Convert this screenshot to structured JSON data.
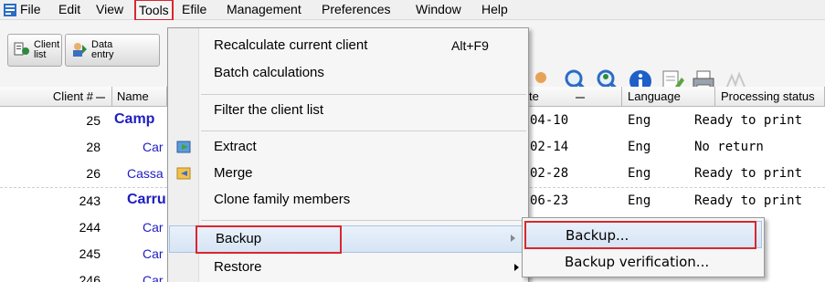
{
  "menubar": {
    "items": [
      "File",
      "Edit",
      "View",
      "Tools",
      "Efile",
      "Management",
      "Preferences",
      "Window",
      "Help"
    ]
  },
  "toolbar": {
    "client_list_line1": "Client",
    "client_list_line2": "list",
    "data_entry_line1": "Data",
    "data_entry_line2": "entry"
  },
  "grid": {
    "headers": {
      "client_no": "Client #",
      "name": "Name",
      "date": "te",
      "language": "Language",
      "processing_status": "Processing status"
    },
    "rows": [
      {
        "num": "25",
        "name": "Camp",
        "date": "04-10",
        "language": "Eng",
        "status": "Ready to print"
      },
      {
        "num": "28",
        "name": "Car",
        "date": "02-14",
        "language": "Eng",
        "status": "No return"
      },
      {
        "num": "26",
        "name": "Cassa",
        "date": "02-28",
        "language": "Eng",
        "status": "Ready to print"
      },
      {
        "num": "243",
        "name": "Carru",
        "date": "06-23",
        "language": "Eng",
        "status": "Ready to print"
      },
      {
        "num": "244",
        "name": "Car",
        "date": "",
        "language": "",
        "status": ""
      },
      {
        "num": "245",
        "name": "Car",
        "date": "",
        "language": "",
        "status": ""
      },
      {
        "num": "246",
        "name": "Car",
        "date": "",
        "language": "",
        "status": ""
      }
    ]
  },
  "tools_menu": {
    "items": [
      {
        "label": "Recalculate current client",
        "shortcut": "Alt+F9"
      },
      {
        "label": "Batch calculations"
      },
      {
        "label": "Filter the client list"
      },
      {
        "label": "Extract"
      },
      {
        "label": "Merge"
      },
      {
        "label": "Clone family members"
      },
      {
        "label": "Backup"
      },
      {
        "label": "Restore"
      }
    ]
  },
  "backup_submenu": {
    "items": [
      {
        "label": "Backup..."
      },
      {
        "label": "Backup verification..."
      }
    ]
  },
  "colors": {
    "highlight_red": "#d9272e",
    "link_blue": "#1d1dc4"
  }
}
